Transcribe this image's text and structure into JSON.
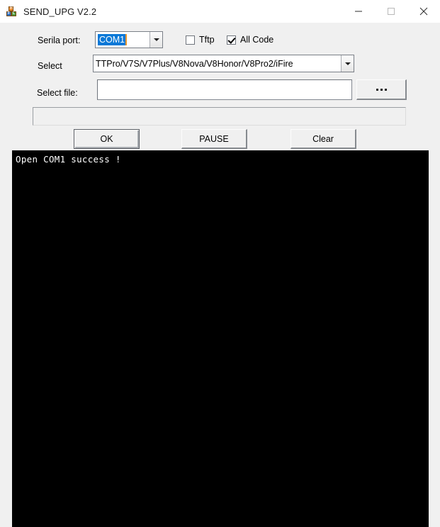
{
  "window": {
    "title": "SEND_UPG V2.2",
    "icon": "blocks-icon",
    "controls": {
      "minimize": "minimize-icon",
      "maximize": "maximize-icon",
      "close": "close-icon"
    },
    "background": "#f0f0f0",
    "titlebar_background": "#ffffff"
  },
  "form": {
    "serial_port": {
      "label": "Serila port:",
      "value": "COM1",
      "selection_color": "#0a78d7"
    },
    "tftp": {
      "label": "Tftp",
      "checked": false
    },
    "all_code": {
      "label": "All Code",
      "checked": true
    },
    "select": {
      "label": "Select",
      "value": "TTPro/V7S/V7Plus/V8Nova/V8Honor/V8Pro2/iFire"
    },
    "select_file": {
      "label": "Select file:",
      "value": "",
      "placeholder": "",
      "browse_label": "..."
    },
    "progress": {
      "percent": 0
    },
    "buttons": {
      "ok": "OK",
      "pause": "PAUSE",
      "clear": "Clear"
    }
  },
  "console": {
    "background": "#000000",
    "text_color": "#ffffff",
    "lines": [
      "Open COM1 success !"
    ]
  }
}
